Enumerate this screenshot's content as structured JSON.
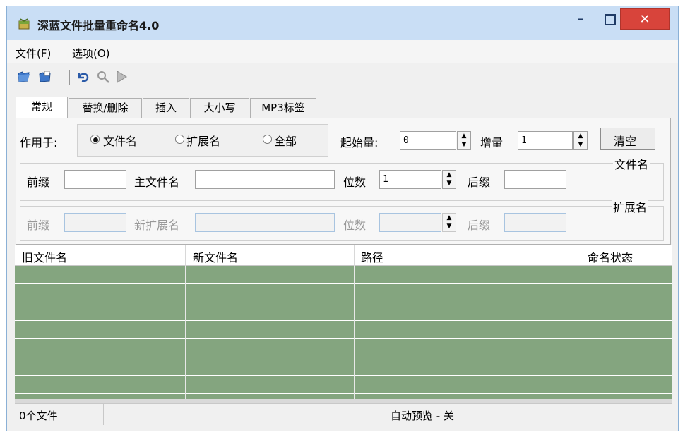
{
  "window": {
    "title": "深蓝文件批量重命名4.0",
    "min_glyph": "–",
    "close_glyph": "✕"
  },
  "menu": [
    {
      "label": "文件(F)"
    },
    {
      "label": "选项(O)"
    }
  ],
  "toolbar_icons": [
    "open-file-icon",
    "open-folder-icon",
    "undo-icon",
    "preview-search-icon",
    "run-icon"
  ],
  "tabs": [
    {
      "label": "常规",
      "active": true
    },
    {
      "label": "替换/删除"
    },
    {
      "label": "插入"
    },
    {
      "label": "大小写"
    },
    {
      "label": "MP3标签"
    }
  ],
  "general": {
    "apply_to_label": "作用于:",
    "radios": [
      {
        "label": "文件名",
        "selected": true
      },
      {
        "label": "扩展名",
        "selected": false
      },
      {
        "label": "全部",
        "selected": false
      }
    ],
    "start_label": "起始量:",
    "start_value": "0",
    "step_label": "增量",
    "step_value": "1",
    "clear_button": "清空"
  },
  "filename_group": {
    "title": "文件名",
    "prefix_label": "前缀",
    "prefix_value": "",
    "main_label": "主文件名",
    "main_value": "",
    "digits_label": "位数",
    "digits_value": "1",
    "suffix_label": "后缀",
    "suffix_value": ""
  },
  "ext_group": {
    "title": "扩展名",
    "prefix_label": "前缀",
    "newext_label": "新扩展名",
    "digits_label": "位数",
    "suffix_label": "后缀"
  },
  "columns": [
    "旧文件名",
    "新文件名",
    "路径",
    "命名状态"
  ],
  "status": {
    "file_count": "0个文件",
    "auto_preview": "自动预览 - 关"
  },
  "colors": {
    "list_bg": "#84a57f",
    "title_bg": "#c9def5",
    "close_bg": "#d8443b"
  }
}
